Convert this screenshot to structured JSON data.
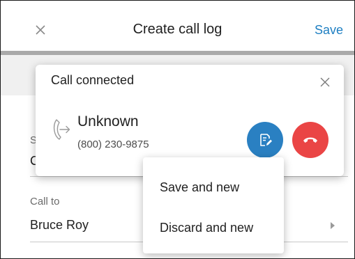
{
  "header": {
    "title": "Create call log",
    "save_label": "Save",
    "close_icon": "close-icon",
    "accent": "#1e7fc2"
  },
  "form": {
    "field_a": {
      "label": "S",
      "value": "C"
    },
    "field_b": {
      "label": "Call to",
      "value": "Bruce Roy"
    }
  },
  "call_card": {
    "title": "Call connected",
    "caller_name": "Unknown",
    "caller_number": "(800) 230-9875",
    "icons": {
      "direction": "phone-outgoing-icon",
      "note": "edit-note-icon",
      "hangup": "hang-up-icon",
      "close": "close-icon"
    },
    "colors": {
      "note_button": "#2a80c2",
      "hangup_button": "#ea4545"
    }
  },
  "menu": {
    "items": [
      "Save and new",
      "Discard and new"
    ]
  }
}
